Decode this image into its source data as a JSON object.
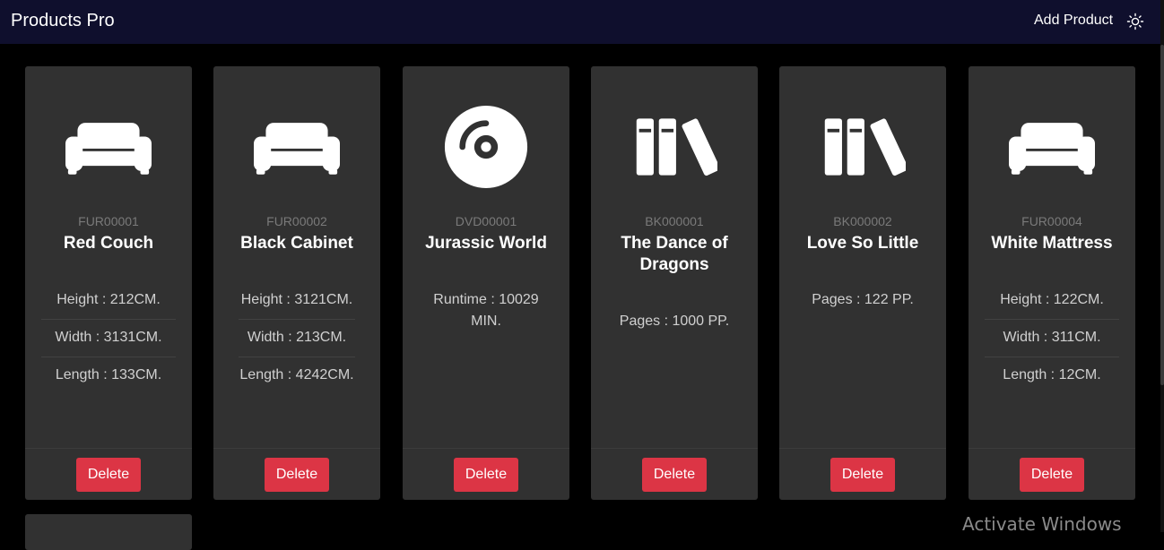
{
  "app": {
    "brand": "Products Pro",
    "add_product_label": "Add Product",
    "theme_icon": "sun-icon"
  },
  "colors": {
    "navbar_bg": "#0f0f2d",
    "page_bg": "#000000",
    "card_bg": "#313131",
    "delete_bg": "#dc3545"
  },
  "products": [
    {
      "sku": "FUR00001",
      "name": "Red Couch",
      "icon": "couch-icon",
      "attributes": [
        "Height : 212CM.",
        "Width : 3131CM.",
        "Length : 133CM."
      ],
      "delete_label": "Delete"
    },
    {
      "sku": "FUR00002",
      "name": "Black Cabinet",
      "icon": "couch-icon",
      "attributes": [
        "Height : 3121CM.",
        "Width : 213CM.",
        "Length : 4242CM."
      ],
      "delete_label": "Delete"
    },
    {
      "sku": "DVD00001",
      "name": "Jurassic World",
      "icon": "compact-disc-icon",
      "attributes": [
        "Runtime : 10029 MIN."
      ],
      "delete_label": "Delete"
    },
    {
      "sku": "BK000001",
      "name": "The Dance of Dragons",
      "icon": "books-icon",
      "attributes": [
        "Pages : 1000 PP."
      ],
      "delete_label": "Delete"
    },
    {
      "sku": "BK000002",
      "name": "Love So Little",
      "icon": "books-icon",
      "attributes": [
        "Pages : 122 PP."
      ],
      "delete_label": "Delete"
    },
    {
      "sku": "FUR00004",
      "name": "White Mattress",
      "icon": "couch-icon",
      "attributes": [
        "Height : 122CM.",
        "Width : 311CM.",
        "Length : 12CM."
      ],
      "delete_label": "Delete"
    }
  ],
  "watermark": "Activate Windows"
}
